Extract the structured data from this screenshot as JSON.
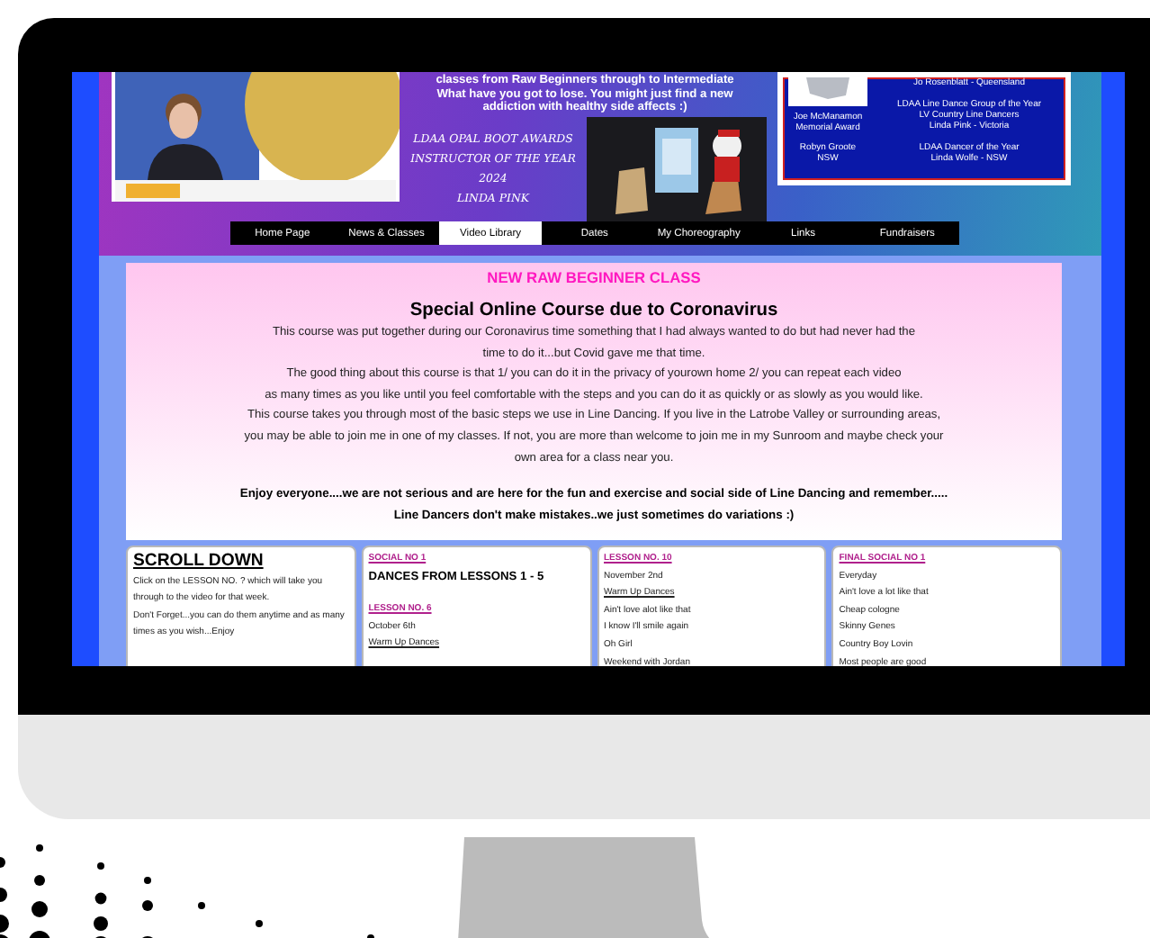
{
  "header": {
    "intro_lines": [
      "classes from Raw Beginners through to Intermediate",
      "What have you got to lose. You might just find a new",
      "addiction with healthy side affects :)"
    ],
    "award_lines": [
      "LDAA OPAL BOOT AWARDS",
      "INSTRUCTOR OF THE YEAR",
      "2024",
      "LINDA PINK"
    ],
    "panel": {
      "left": [
        [
          "Joe McManamon",
          "Memorial Award"
        ],
        [
          "Robyn Groote",
          "NSW"
        ]
      ],
      "right": [
        [
          "Jo Rosenblatt - Queensland"
        ],
        [
          "LDAA Line Dance Group of the Year",
          "LV Country Line Dancers",
          "Linda Pink - Victoria"
        ],
        [
          "LDAA Dancer of the Year",
          "Linda Wolfe - NSW"
        ]
      ]
    }
  },
  "nav": [
    {
      "label": "Home Page",
      "selected": false
    },
    {
      "label": "News & Classes",
      "selected": false
    },
    {
      "label": "Video Library",
      "selected": true
    },
    {
      "label": "Dates",
      "selected": false
    },
    {
      "label": "My Choreography",
      "selected": false
    },
    {
      "label": "Links",
      "selected": false
    },
    {
      "label": "Fundraisers",
      "selected": false
    }
  ],
  "notice": {
    "title": "NEW RAW BEGINNER CLASS",
    "heading": "Special Online Course due to Coronavirus",
    "paragraph": [
      "This course was put together during our Coronavirus time something that I had always wanted to do but had never had the",
      "time to do it...but Covid gave me that time.",
      "The good thing about this course is that 1/ you can do it in the privacy of yourown home 2/ you can repeat each video",
      "as many times as you like until you feel comfortable with the steps and you can do it as quickly or as slowly as you would like.",
      "This course takes you through most of the basic steps we use in Line Dancing. If you live in the Latrobe Valley or surrounding areas,",
      "you may be able to join me in one of my classes. If not, you are more than welcome to join me in my Sunroom and maybe check your",
      "own area for a class near you."
    ],
    "closing": [
      "Enjoy everyone....we are not serious and are here for the fun and exercise and social side of Line Dancing and remember.....",
      "Line Dancers don't make mistakes..we just sometimes do variations :)"
    ]
  },
  "cards": [
    {
      "sections": [
        [
          {
            "kind": "title",
            "text": "SCROLL DOWN"
          },
          {
            "kind": "text",
            "text": "Click on the LESSON NO. ? which will take you through to the video for that week."
          },
          {
            "kind": "text",
            "text": "Don't Forget...you can do them anytime and as many times as you wish...Enjoy"
          }
        ]
      ]
    },
    {
      "sections": [
        [
          {
            "kind": "link",
            "text": "SOCIAL NO 1"
          },
          {
            "kind": "bold",
            "text": "DANCES FROM LESSONS 1 - 5"
          }
        ],
        [
          {
            "kind": "link",
            "text": "LESSON NO. 6"
          },
          {
            "kind": "text",
            "text": "October 6th"
          },
          {
            "kind": "underline",
            "text": "Warm Up Dances"
          }
        ]
      ]
    },
    {
      "sections": [
        [
          {
            "kind": "link",
            "text": "LESSON NO. 10"
          },
          {
            "kind": "text",
            "text": "November 2nd"
          },
          {
            "kind": "underline",
            "text": "Warm Up Dances"
          },
          {
            "kind": "text",
            "text": "Ain't love alot like that"
          },
          {
            "kind": "text",
            "text": "I know I'll smile again"
          },
          {
            "kind": "text",
            "text": "Oh Girl"
          },
          {
            "kind": "text",
            "text": "Weekend with Jordan"
          }
        ]
      ]
    },
    {
      "sections": [
        [
          {
            "kind": "link",
            "text": "FINAL SOCIAL NO 1"
          },
          {
            "kind": "text",
            "text": "Everyday"
          },
          {
            "kind": "text",
            "text": "Ain't love a lot like that"
          },
          {
            "kind": "text",
            "text": "Cheap cologne"
          },
          {
            "kind": "text",
            "text": "Skinny Genes"
          },
          {
            "kind": "text",
            "text": "Country Boy Lovin"
          },
          {
            "kind": "text",
            "text": "Most people are good"
          }
        ]
      ]
    }
  ]
}
